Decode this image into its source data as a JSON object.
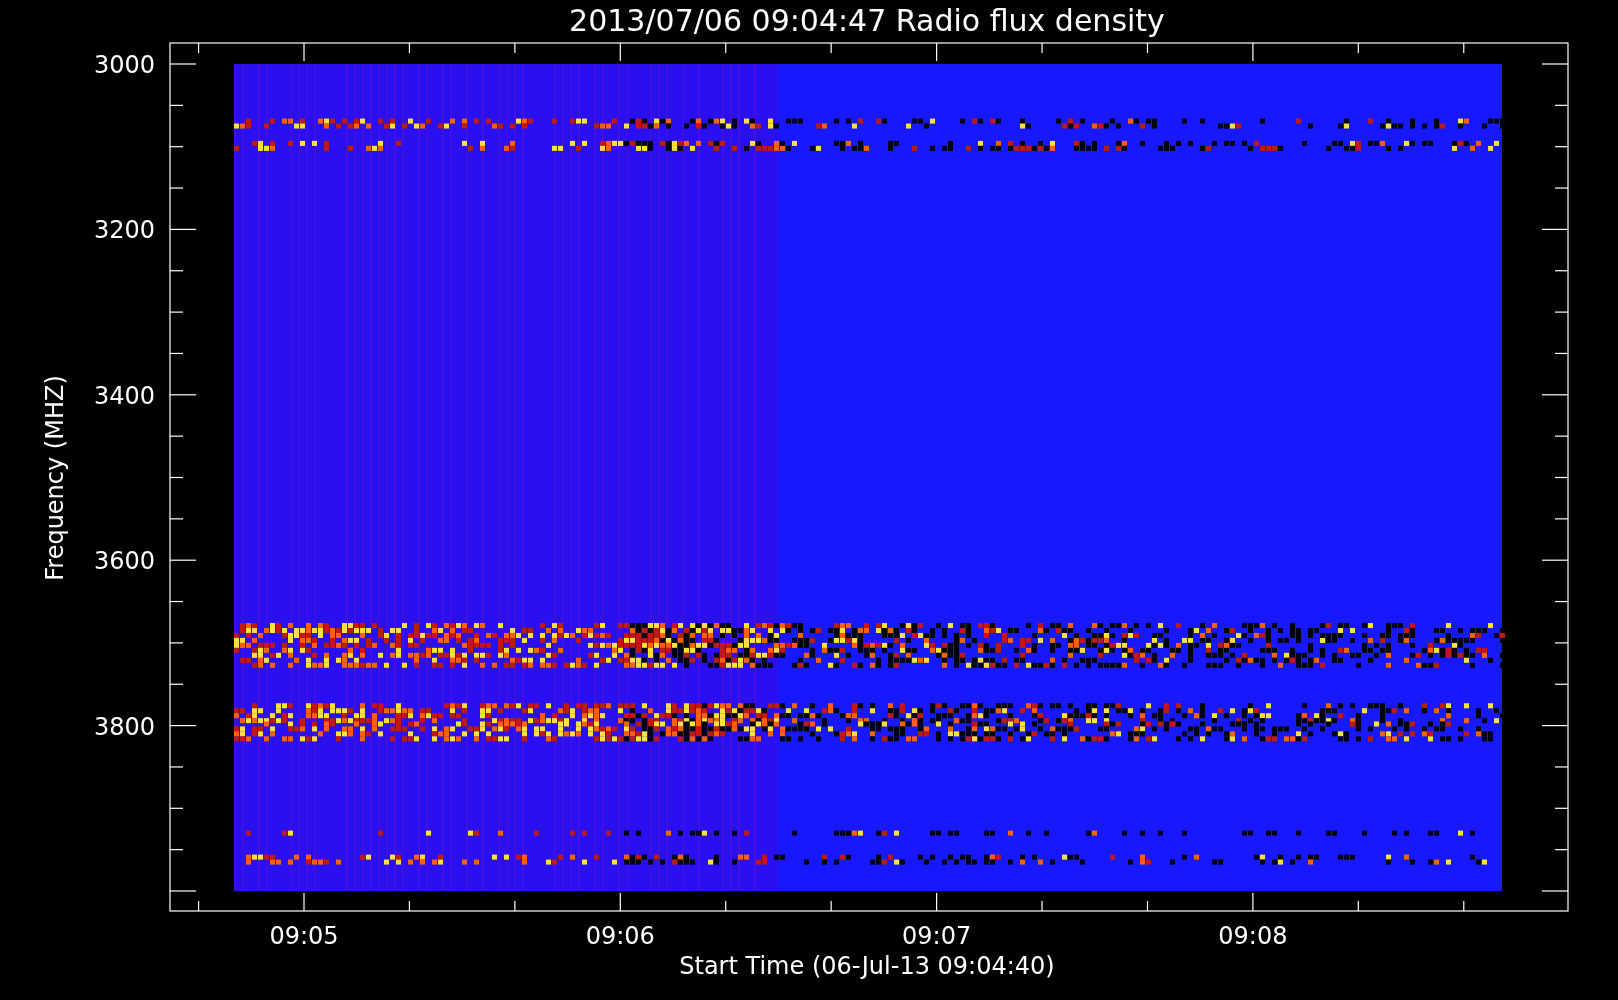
{
  "title": "2013/07/06 09:04:47 Radio flux density",
  "y_axis": {
    "label": "Frequency (MHZ)",
    "ticks": [
      "3000",
      "3200",
      "3400",
      "3600",
      "3800"
    ]
  },
  "x_axis": {
    "label": "Start Time (06-Jul-13 09:04:40)",
    "ticks": [
      "09:05",
      "09:06",
      "09:07",
      "09:08"
    ]
  }
}
